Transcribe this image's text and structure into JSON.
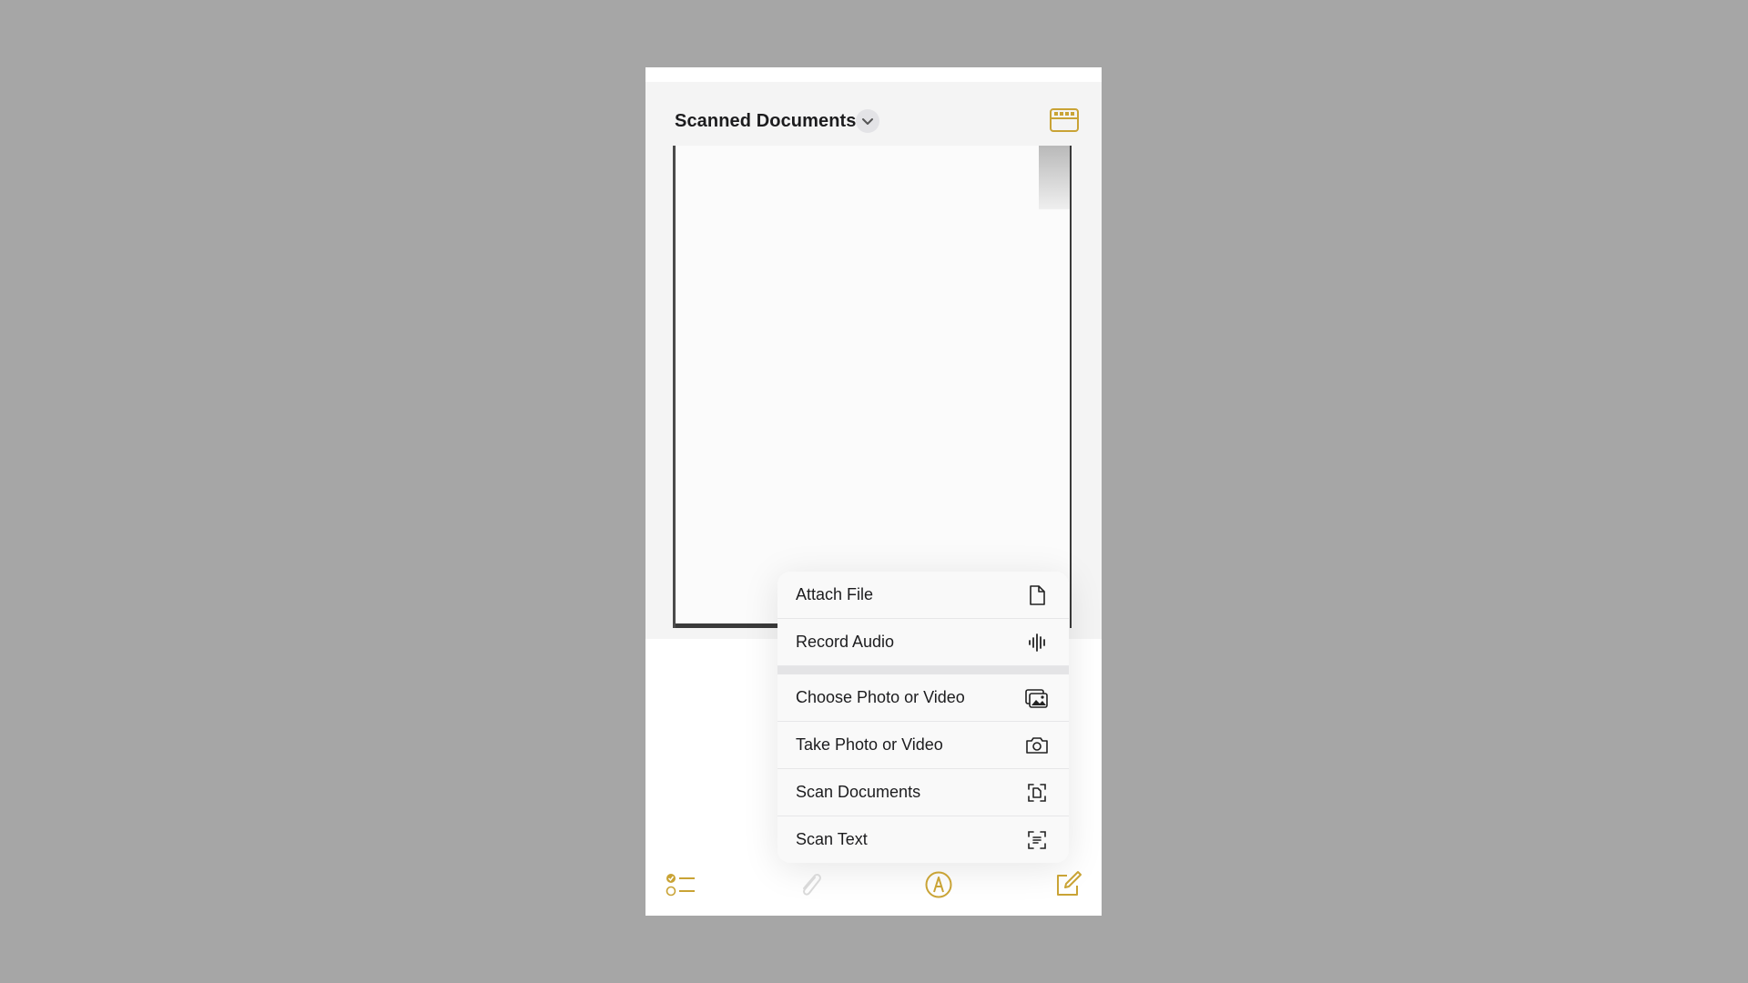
{
  "header": {
    "title": "Scanned Documents",
    "chevron_icon": "chevron-down-icon",
    "right_icon": "table-view-icon"
  },
  "attachment_menu": {
    "items": [
      {
        "label": "Attach File",
        "icon": "document-icon"
      },
      {
        "label": "Record Audio",
        "icon": "waveform-icon"
      },
      {
        "label": "Choose Photo or Video",
        "icon": "photo-library-icon"
      },
      {
        "label": "Take Photo or Video",
        "icon": "camera-icon"
      },
      {
        "label": "Scan Documents",
        "icon": "scan-document-icon"
      },
      {
        "label": "Scan Text",
        "icon": "scan-text-icon"
      }
    ]
  },
  "toolbar": {
    "items": [
      {
        "icon": "checklist-icon"
      },
      {
        "icon": "paperclip-icon"
      },
      {
        "icon": "markup-pen-icon"
      },
      {
        "icon": "compose-icon"
      }
    ]
  },
  "colors": {
    "accent": "#c9a335",
    "background": "#a6a6a6",
    "menu_background": "#f9f9f9",
    "text": "#1c1c1e"
  }
}
